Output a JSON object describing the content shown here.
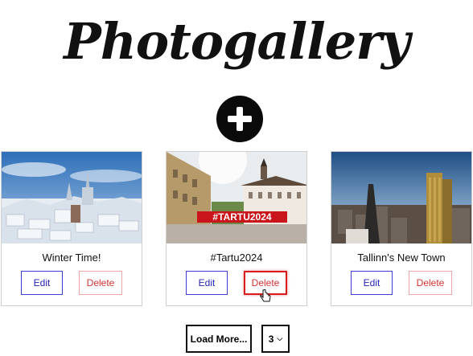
{
  "header": {
    "title": "Photogallery"
  },
  "add_button": {
    "icon": "plus-icon"
  },
  "cards": [
    {
      "caption": "Winter Time!",
      "edit_label": "Edit",
      "delete_label": "Delete"
    },
    {
      "caption": "#Tartu2024",
      "edit_label": "Edit",
      "delete_label": "Delete"
    },
    {
      "caption": "Tallinn's New Town",
      "edit_label": "Edit",
      "delete_label": "Delete"
    }
  ],
  "photo_texts": {
    "tartu_sign": "#TARTU2024"
  },
  "pagination": {
    "load_more_label": "Load More...",
    "page_size_value": "3"
  },
  "colors": {
    "edit": "#2424b8",
    "delete": "#d23434",
    "accent_active": "#d81c1c"
  }
}
